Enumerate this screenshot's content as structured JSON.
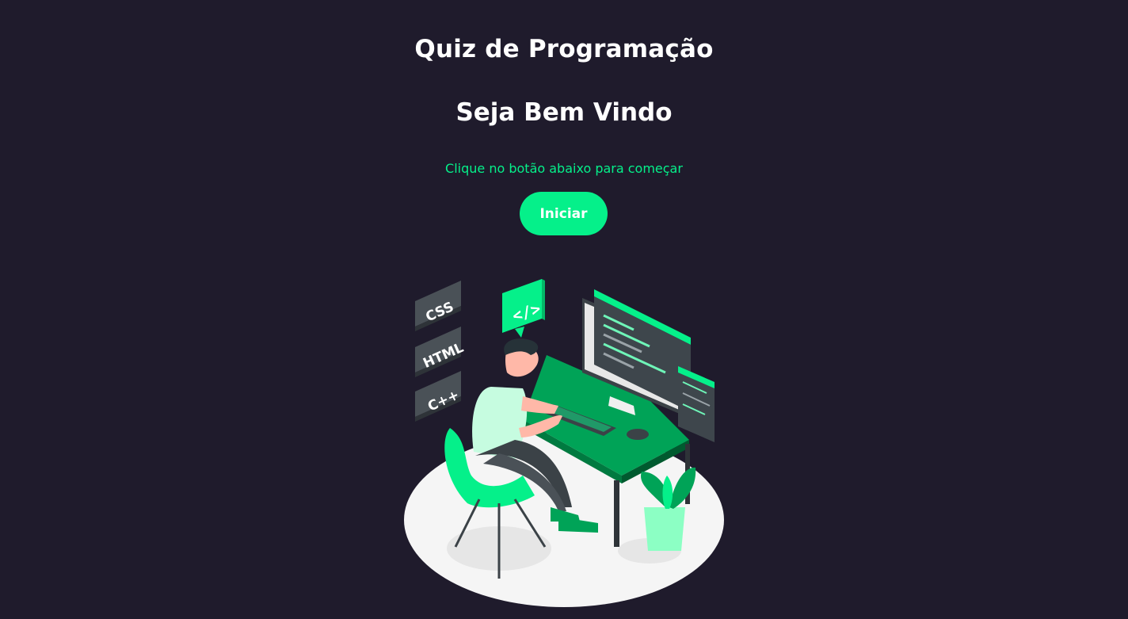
{
  "header": {
    "title": "Quiz de Programação",
    "welcome": "Seja Bem Vindo",
    "hint": "Clique no botão abaixo para começar"
  },
  "actions": {
    "start_label": "Iniciar"
  },
  "illustration": {
    "tags": [
      "CSS",
      "HTML",
      "C++"
    ],
    "code_bubble": "</>"
  },
  "colors": {
    "background": "#1f1b2c",
    "accent": "#05f08a",
    "text": "#ffffff"
  }
}
